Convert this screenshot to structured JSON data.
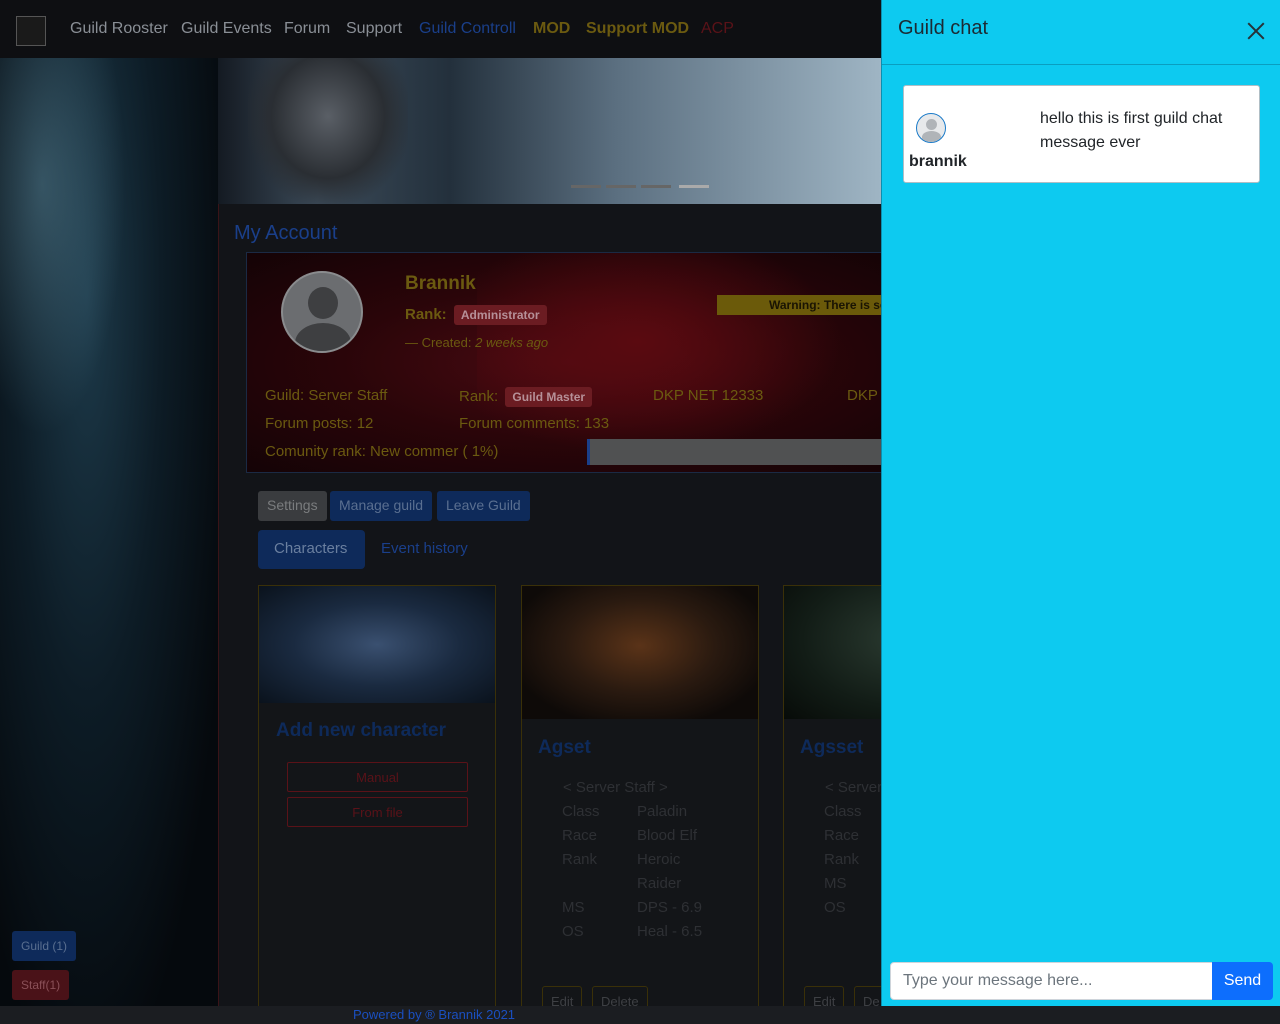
{
  "nav": {
    "items": [
      {
        "label": "Guild Rooster",
        "color": "#8a8f96"
      },
      {
        "label": "Guild Events",
        "color": "#8a8f96"
      },
      {
        "label": "Forum",
        "color": "#8a8f96"
      },
      {
        "label": "Support",
        "color": "#8a8f96"
      },
      {
        "label": "Guild Controll",
        "color": "#1a3f8a"
      },
      {
        "label": "MOD",
        "color": "#6b5a10"
      },
      {
        "label": "Support MOD",
        "color": "#6b5a10"
      },
      {
        "label": "ACP",
        "color": "#5a1218"
      }
    ]
  },
  "account": {
    "title": "My Account",
    "name": "Brannik",
    "rank_label": "Rank:",
    "rank_badge": "Administrator",
    "created_prefix": "— Created:",
    "created_value": "2 weeks ago",
    "warning": "Warning: There is so",
    "guild": "Guild: Server Staff",
    "guild_rank_label": "Rank:",
    "guild_rank_badge": "Guild Master",
    "dkp_net": "DKP NET 12333",
    "dkp": "DKP",
    "forum_posts": "Forum posts: 12",
    "forum_comments": "Forum comments: 133",
    "community_rank": "Comunity rank: New commer ( 1%)",
    "community_progress": 0.01
  },
  "actions": {
    "settings": "Settings",
    "manage_guild": "Manage guild",
    "leave_guild": "Leave Guild"
  },
  "tabs": {
    "characters": "Characters",
    "event_history": "Event history"
  },
  "cards": {
    "add": {
      "title": "Add new character",
      "manual": "Manual",
      "from_file": "From file"
    },
    "char1": {
      "name": "Agset",
      "guild": "< Server Staff >",
      "class_label": "Class",
      "class_value": "Paladin",
      "race_label": "Race",
      "race_value": "Blood Elf",
      "rank_label": "Rank",
      "rank_value": "Heroic",
      "rank_value2": "Raider",
      "ms_label": "MS",
      "ms_value": "DPS - 6.9",
      "os_label": "OS",
      "os_value": "Heal - 6.5",
      "edit": "Edit",
      "delete": "Delete"
    },
    "char2": {
      "name": "Agsset",
      "guild": "< Server",
      "class_label": "Class",
      "race_label": "Race",
      "rank_label": "Rank",
      "ms_label": "MS",
      "os_label": "OS",
      "edit": "Edit",
      "delete": "De"
    }
  },
  "sidebar_buttons": {
    "guild": "Guild (1)",
    "staff": "Staff(1)"
  },
  "footer": "Powered by ® Brannik 2021",
  "chat": {
    "title": "Guild chat",
    "messages": [
      {
        "user": "brannik",
        "text": "hello this is first guild chat message ever"
      }
    ],
    "input_placeholder": "Type your message here...",
    "send": "Send"
  }
}
